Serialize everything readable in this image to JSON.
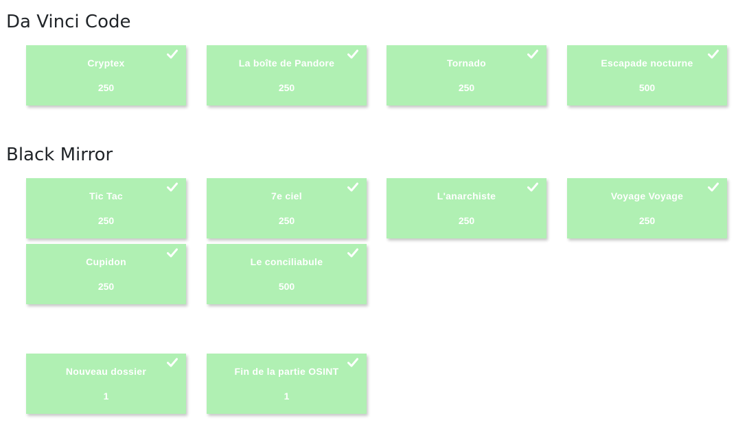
{
  "categories": [
    {
      "title": "Da Vinci Code",
      "challenges": [
        {
          "name": "Cryptex",
          "value": "250"
        },
        {
          "name": "La boîte de Pandore",
          "value": "250"
        },
        {
          "name": "Tornado",
          "value": "250"
        },
        {
          "name": "Escapade nocturne",
          "value": "500"
        }
      ]
    },
    {
      "title": "Black Mirror",
      "challenges": [
        {
          "name": "Tic Tac",
          "value": "250"
        },
        {
          "name": "7e ciel",
          "value": "250"
        },
        {
          "name": "L'anarchiste",
          "value": "250"
        },
        {
          "name": "Voyage Voyage",
          "value": "250"
        },
        {
          "name": "Cupidon",
          "value": "250"
        },
        {
          "name": "Le conciliabule",
          "value": "500"
        }
      ]
    },
    {
      "title": "",
      "challenges": [
        {
          "name": "Nouveau dossier",
          "value": "1"
        },
        {
          "name": "Fin de la partie OSINT",
          "value": "1"
        }
      ]
    }
  ],
  "icons": {
    "solved": "check-icon"
  },
  "colors": {
    "solved_card": "#b0f0b3",
    "card_text": "#ffffff"
  }
}
